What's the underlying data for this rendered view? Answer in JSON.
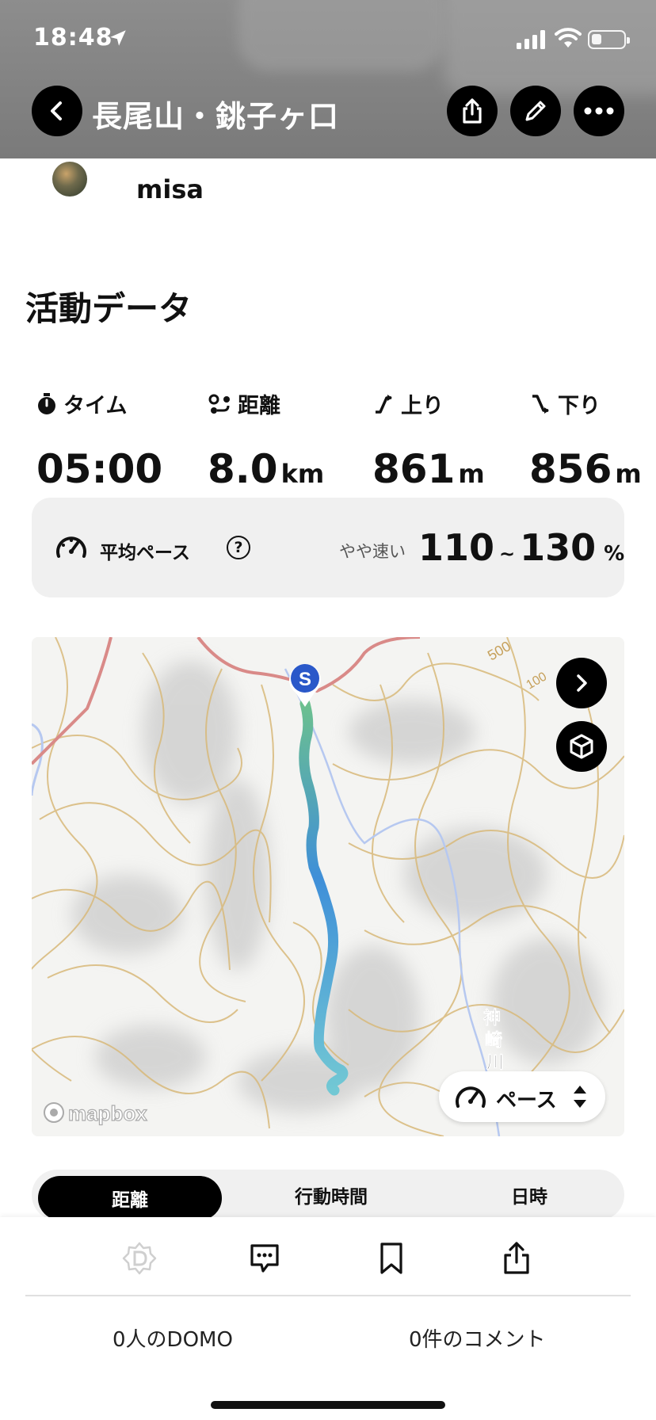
{
  "status_bar": {
    "time": "18:48",
    "location_icon": "location-arrow-icon",
    "signal_icon": "cellular-signal-icon",
    "wifi_icon": "wifi-icon",
    "battery_icon": "battery-icon"
  },
  "header": {
    "title": "長尾山・銚子ヶ口",
    "back_icon": "chevron-left-icon",
    "share_icon": "share-icon",
    "edit_icon": "pencil-icon",
    "more_icon": "more-icon"
  },
  "user": {
    "name": "misa"
  },
  "section_title": "活動データ",
  "stats": [
    {
      "label": "タイム",
      "value": "05:00",
      "unit": "",
      "icon": "stopwatch-icon"
    },
    {
      "label": "距離",
      "value": "8.0",
      "unit": "km",
      "icon": "route-icon"
    },
    {
      "label": "上り",
      "value": "861",
      "unit": "m",
      "icon": "ascent-icon"
    },
    {
      "label": "下り",
      "value": "856",
      "unit": "m",
      "icon": "descent-icon"
    }
  ],
  "pace": {
    "label": "平均ペース",
    "help": "?",
    "description": "やや速い",
    "min": "110",
    "separator": "~",
    "max": "130",
    "unit": "%"
  },
  "map": {
    "start_marker": "S",
    "attribution": "mapbox",
    "labels": {
      "elev_500": "500",
      "elev_100": "100",
      "river_1": "神",
      "river_2": "崎",
      "river_3": "川"
    },
    "route_colors": {
      "start": "#6cc08f",
      "mid": "#3f8fd8",
      "end": "#72c8d4"
    },
    "toggle_label": "ペース",
    "next_icon": "chevron-right-icon",
    "view3d_icon": "cube-icon"
  },
  "tabs": [
    {
      "label": "距離",
      "active": true
    },
    {
      "label": "行動時間",
      "active": false
    },
    {
      "label": "日時",
      "active": false
    }
  ],
  "bottom_bar": {
    "domo_icon": "domo-icon",
    "comment_icon": "comment-icon",
    "bookmark_icon": "bookmark-icon",
    "share_icon": "share-icon",
    "domo_count": "0人のDOMO",
    "comment_count": "0件のコメント"
  }
}
